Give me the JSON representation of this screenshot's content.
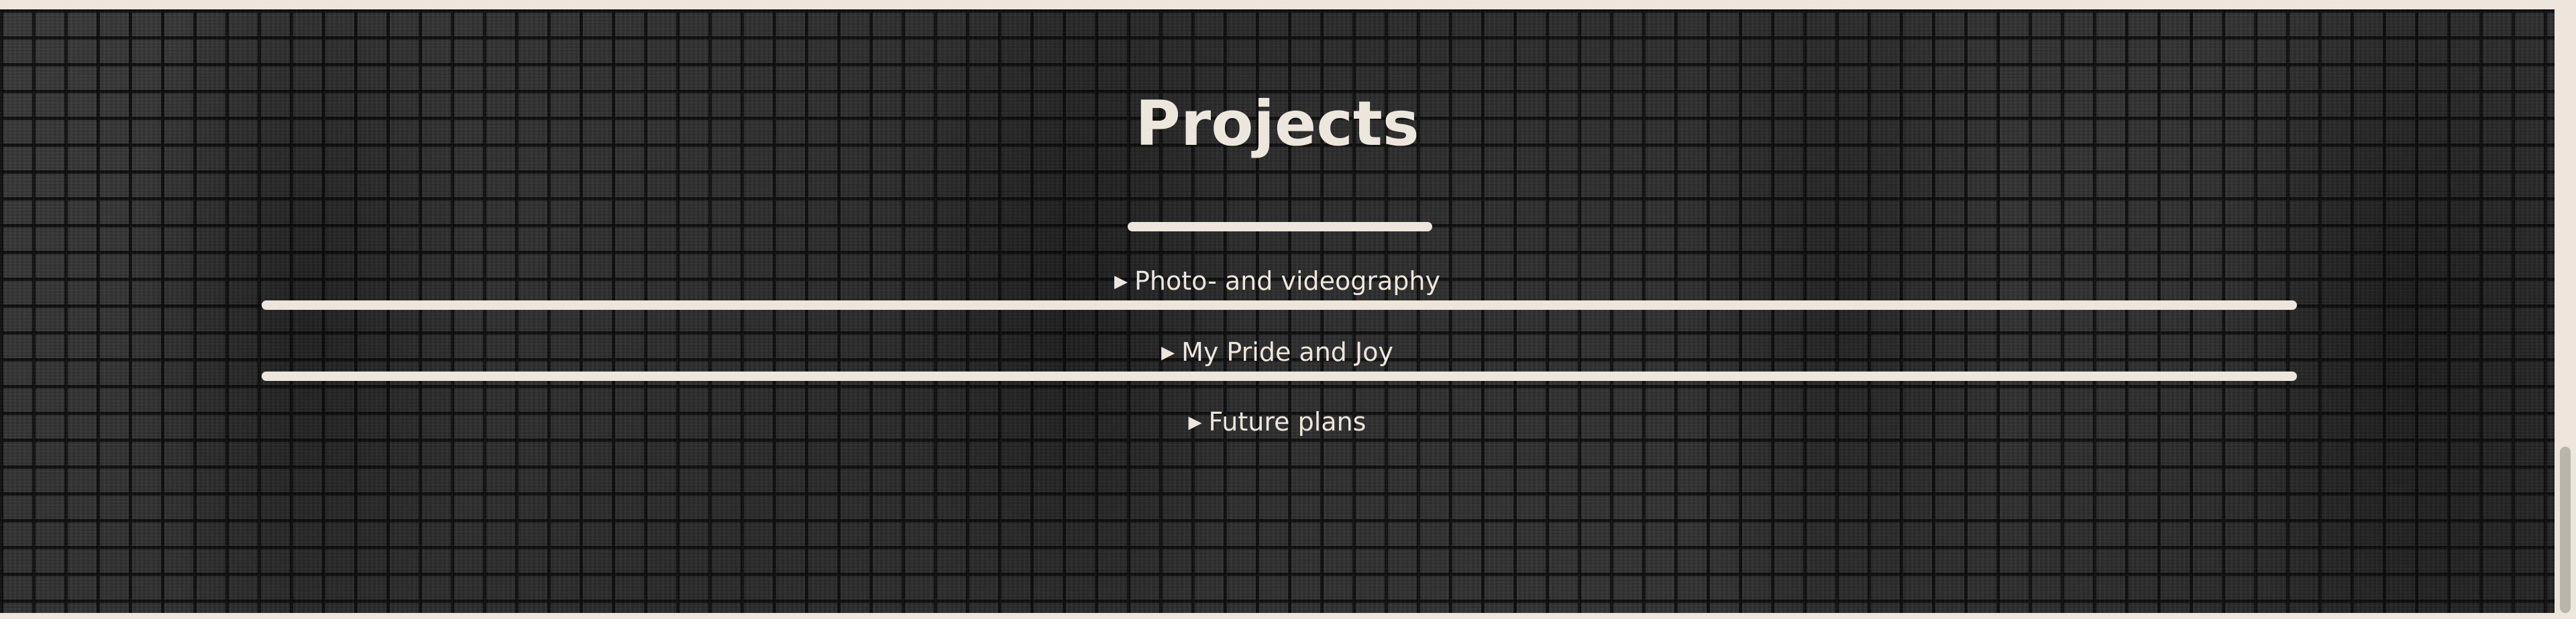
{
  "section": {
    "title": "Projects"
  },
  "items": [
    {
      "label": "Photo- and videography",
      "marker": "▶"
    },
    {
      "label": "My Pride and Joy",
      "marker": "▶"
    },
    {
      "label": "Future plans",
      "marker": "▶"
    }
  ],
  "colors": {
    "text": "#ece6dc",
    "background": "#262626",
    "frame": "#ece6dc"
  }
}
